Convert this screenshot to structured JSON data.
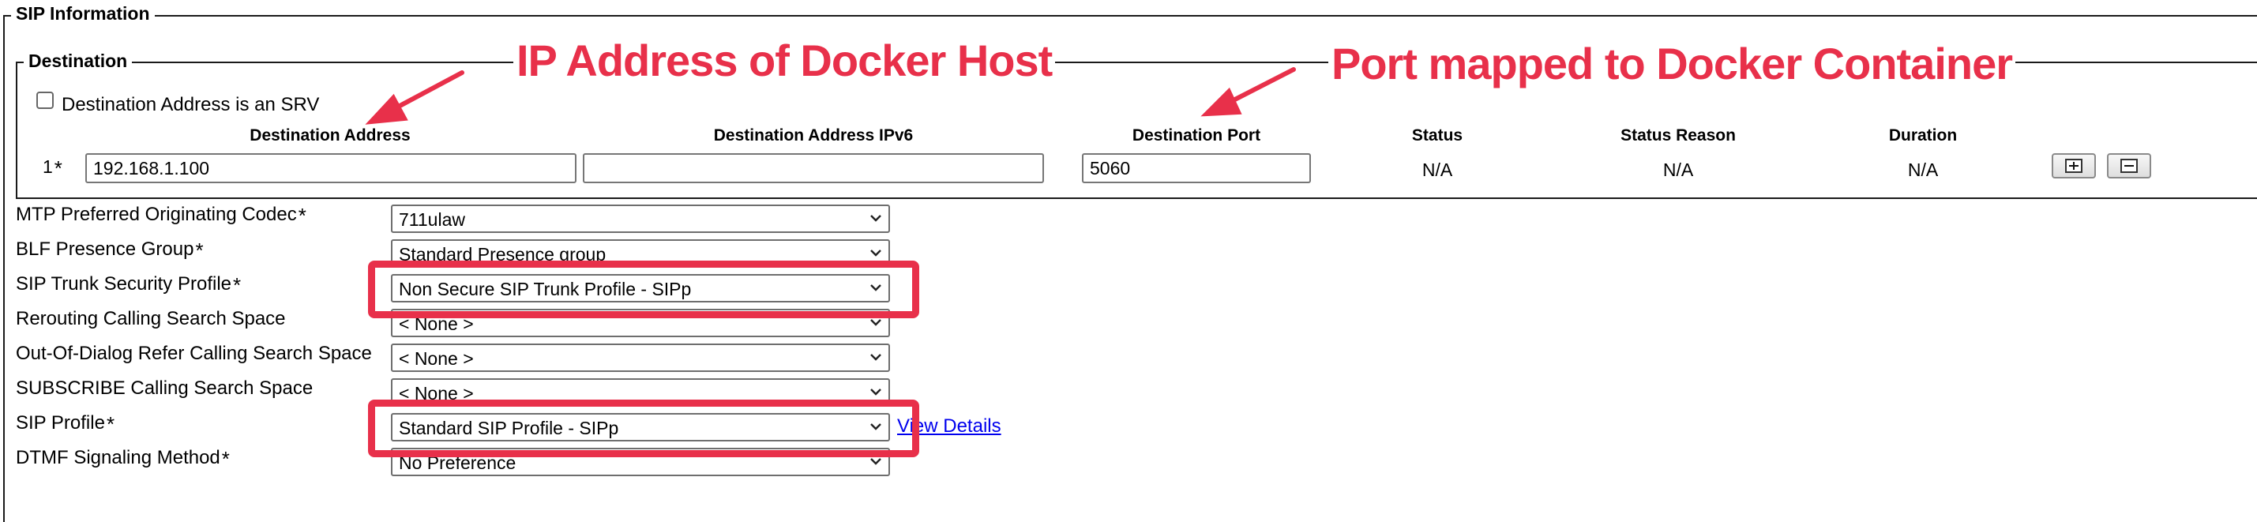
{
  "sip_information": {
    "legend": "SIP Information",
    "destination": {
      "legend": "Destination",
      "srv_checkbox_label": "Destination Address is an SRV",
      "srv_checked": false,
      "columns": {
        "address": "Destination Address",
        "ipv6": "Destination Address IPv6",
        "port": "Destination Port",
        "status": "Status",
        "status_reason": "Status Reason",
        "duration": "Duration"
      },
      "row": {
        "index": "1",
        "required_mark": "*",
        "address": "192.168.1.100",
        "ipv6": "",
        "port": "5060",
        "status": "N/A",
        "status_reason": "N/A",
        "duration": "N/A"
      },
      "buttons": {
        "add_icon": "plus-box-icon",
        "remove_icon": "minus-box-icon"
      }
    },
    "fields": [
      {
        "label": "MTP Preferred Originating Codec",
        "required": "*",
        "value": "711ulaw"
      },
      {
        "label": "BLF Presence Group",
        "required": "*",
        "value": "Standard Presence group"
      },
      {
        "label": "SIP Trunk Security Profile",
        "required": "*",
        "value": "Non Secure SIP Trunk Profile - SIPp"
      },
      {
        "label": "Rerouting Calling Search Space",
        "required": "",
        "value": "< None >"
      },
      {
        "label": "Out-Of-Dialog Refer Calling Search Space",
        "required": "",
        "value": "< None >"
      },
      {
        "label": "SUBSCRIBE Calling Search Space",
        "required": "",
        "value": "< None >"
      },
      {
        "label": "SIP Profile",
        "required": "*",
        "value": "Standard SIP Profile - SIPp"
      },
      {
        "label": "DTMF Signaling Method",
        "required": "*",
        "value": "No Preference"
      }
    ],
    "view_details_link": "View Details"
  },
  "annotations": {
    "ip_callout": "IP Address of Docker Host",
    "port_callout": "Port mapped to Docker Container",
    "color": "#e8304a"
  }
}
